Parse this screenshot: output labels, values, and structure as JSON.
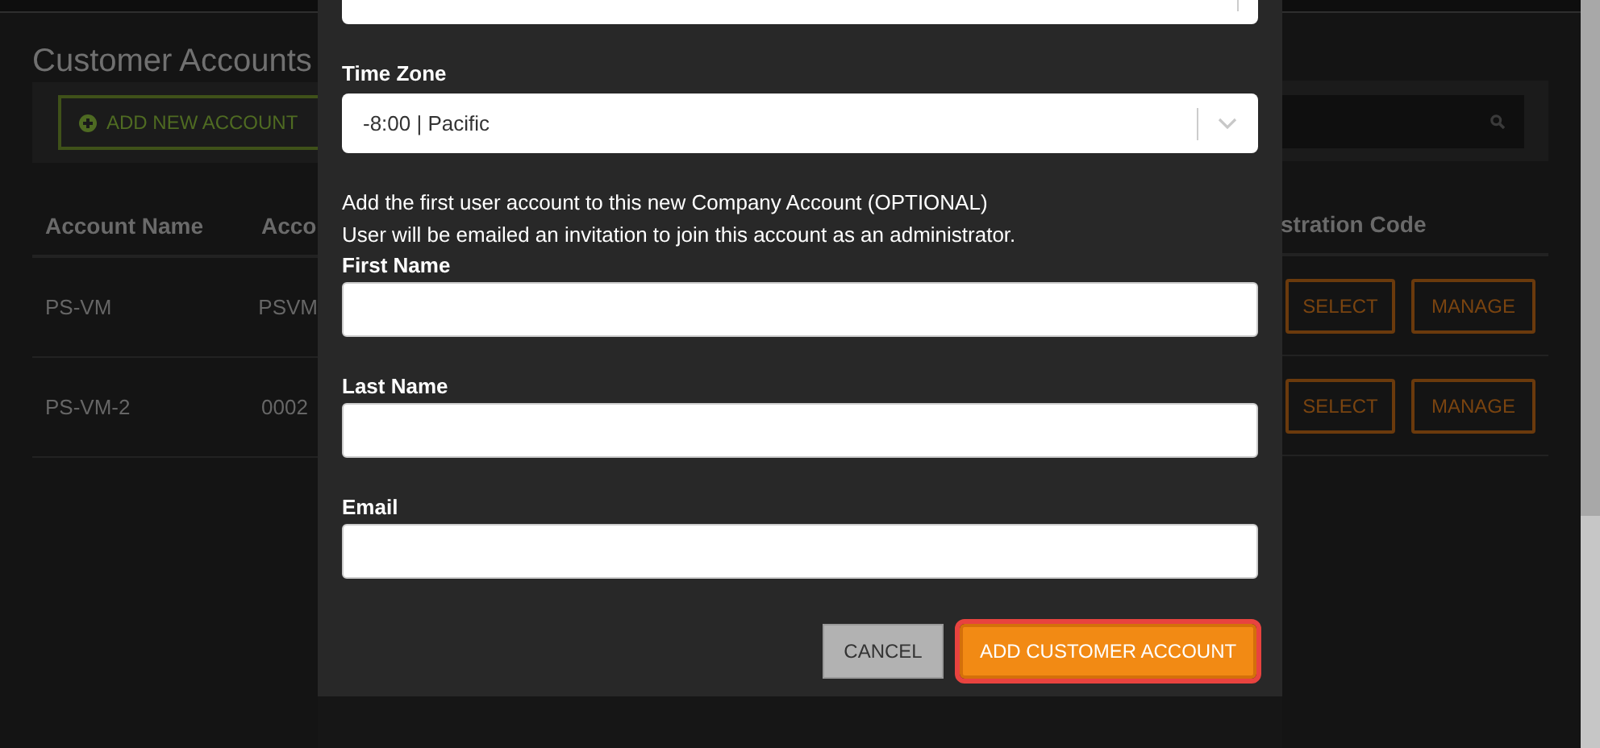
{
  "page": {
    "title": "Customer Accounts",
    "add_button": "ADD NEW ACCOUNT",
    "table": {
      "columns": [
        "Account Name",
        "Acco",
        "stration Code"
      ],
      "rows": [
        {
          "cells": [
            "PS-VM",
            "PSVM"
          ],
          "actions": [
            "SELECT",
            "MANAGE"
          ]
        },
        {
          "cells": [
            "PS-VM-2",
            "0002"
          ],
          "actions": [
            "SELECT",
            "MANAGE"
          ]
        }
      ]
    }
  },
  "modal": {
    "items": [
      {
        "kind": "select"
      },
      {
        "kind": "select",
        "label": "Time Zone",
        "value": "-8:00 | Pacific"
      },
      {
        "kind": "note",
        "lines": [
          "Add the first user account to this new Company Account (OPTIONAL)",
          "User will be emailed an invitation to join this account as an administrator."
        ]
      },
      {
        "kind": "input",
        "label": "First Name"
      },
      {
        "kind": "input",
        "label": "Last Name"
      },
      {
        "kind": "input",
        "label": "Email"
      }
    ],
    "buttons": [
      {
        "label": "CANCEL",
        "kind": "secondary",
        "focused": false
      },
      {
        "label": "ADD CUSTOMER ACCOUNT",
        "kind": "primary",
        "focused": true
      }
    ]
  }
}
